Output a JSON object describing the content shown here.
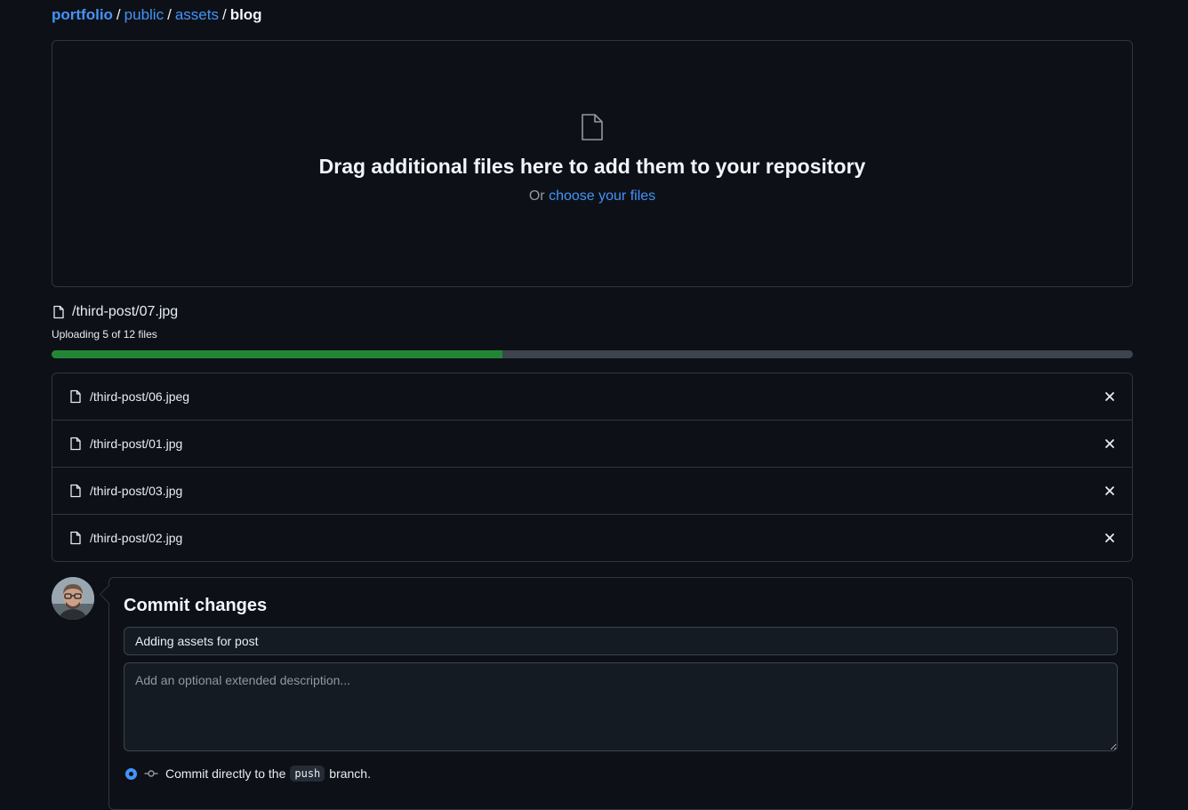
{
  "breadcrumb": {
    "repo": "portfolio",
    "parts": [
      "public",
      "assets"
    ],
    "current": "blog",
    "separator": "/"
  },
  "dropzone": {
    "title": "Drag additional files here to add them to your repository",
    "or_text": "Or",
    "choose_link": "choose your files",
    "icon": "file-icon"
  },
  "upload": {
    "current_file": "/third-post/07.jpg",
    "status": "Uploading 5 of 12 files",
    "done": 5,
    "total": 12,
    "progress_color": "#238636"
  },
  "files": [
    {
      "name": "/third-post/06.jpeg"
    },
    {
      "name": "/third-post/01.jpg"
    },
    {
      "name": "/third-post/03.jpg"
    },
    {
      "name": "/third-post/02.jpg"
    }
  ],
  "commit": {
    "title": "Commit changes",
    "message_value": "Adding assets for post",
    "description_placeholder": "Add an optional extended description...",
    "option_prefix": "Commit directly to the",
    "branch": "push",
    "option_suffix": "branch."
  },
  "colors": {
    "accent": "#4493f8",
    "background": "#0d1117",
    "border": "#30363d",
    "success": "#238636"
  }
}
